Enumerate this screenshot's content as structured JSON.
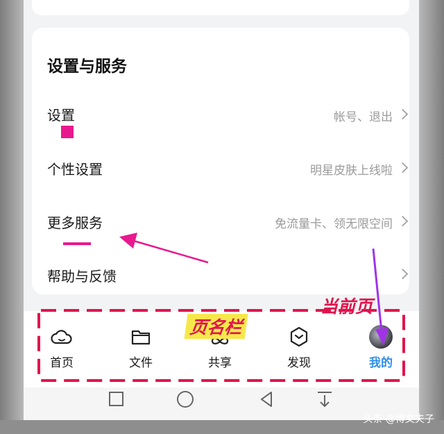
{
  "settings_section": {
    "title": "设置与服务",
    "rows": [
      {
        "label": "设置",
        "desc": "帐号、退出"
      },
      {
        "label": "个性设置",
        "desc": "明星皮肤上线啦"
      },
      {
        "label": "更多服务",
        "desc": "免流量卡、领无限空间"
      },
      {
        "label": "帮助与反馈",
        "desc": ""
      }
    ]
  },
  "bottom_nav": {
    "items": [
      {
        "label": "首页",
        "icon": "cloud-home-icon",
        "active": false
      },
      {
        "label": "文件",
        "icon": "folder-icon",
        "active": false
      },
      {
        "label": "共享",
        "icon": "share-infinity-icon",
        "active": false
      },
      {
        "label": "发现",
        "icon": "discover-hexagon-icon",
        "active": false
      },
      {
        "label": "我的",
        "icon": "avatar",
        "active": true
      }
    ]
  },
  "system_nav": {
    "icons": [
      "square-recent-icon",
      "circle-home-icon",
      "triangle-back-icon",
      "pull-down-icon"
    ]
  },
  "annotations": {
    "page_bar_label": "页名栏",
    "current_page_label": "当前页",
    "highlight_color": "#e0154e",
    "arrow_color": "#a033e8"
  },
  "watermark": "头条 @博文夫子",
  "colors": {
    "active_tab": "#2f8fe8",
    "annotation_pink": "#e8198e"
  }
}
